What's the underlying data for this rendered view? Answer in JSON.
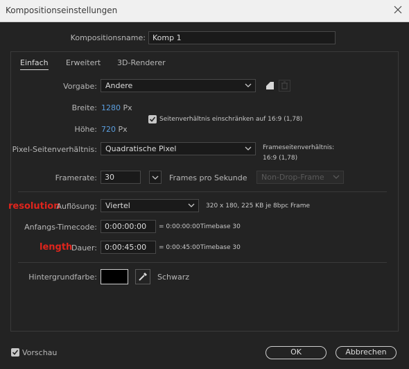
{
  "window": {
    "title": "Kompositionseinstellungen"
  },
  "composition_name": {
    "label": "Kompositionsname:",
    "value": "Komp 1"
  },
  "tabs": [
    {
      "label": "Einfach"
    },
    {
      "label": "Erweitert"
    },
    {
      "label": "3D-Renderer"
    }
  ],
  "preset": {
    "label": "Vorgabe:",
    "value": "Andere"
  },
  "width": {
    "label": "Breite:",
    "value": "1280",
    "unit": "Px"
  },
  "height": {
    "label": "Höhe:",
    "value": "720",
    "unit": "Px"
  },
  "lock_aspect": {
    "label": "Seitenverhältnis einschränken auf 16:9 (1,78)",
    "checked": true
  },
  "pixel_aspect": {
    "label": "Pixel-Seitenverhältnis:",
    "value": "Quadratische Pixel"
  },
  "frame_aspect": {
    "label": "Frameseitenverhältnis:",
    "value": "16:9 (1,78)"
  },
  "framerate": {
    "label": "Framerate:",
    "value": "30",
    "unit_label": "Frames pro Sekunde",
    "drop_frame": "Non-Drop-Frame"
  },
  "resolution": {
    "annotation": "resolution",
    "label": "Auflösung:",
    "value": "Viertel",
    "info": "320 x 180, 225 KB je 8bpc Frame"
  },
  "start_timecode": {
    "label": "Anfangs-Timecode:",
    "value": "0:00:00:00",
    "equals": "= 0:00:00:00",
    "timebase": "Timebase 30"
  },
  "duration": {
    "annotation": "length",
    "label": "Dauer:",
    "value": "0:00:45:00",
    "equals": "= 0:00:45:00",
    "timebase": "Timebase 30"
  },
  "background": {
    "label": "Hintergrundfarbe:",
    "color": "#000000",
    "color_name": "Schwarz"
  },
  "preview": {
    "label": "Vorschau",
    "checked": true
  },
  "buttons": {
    "ok": "OK",
    "cancel": "Abbrechen"
  },
  "colors": {
    "accent_blue": "#5b9fe0",
    "annotation_red": "#e0241c",
    "background": "#232323"
  }
}
